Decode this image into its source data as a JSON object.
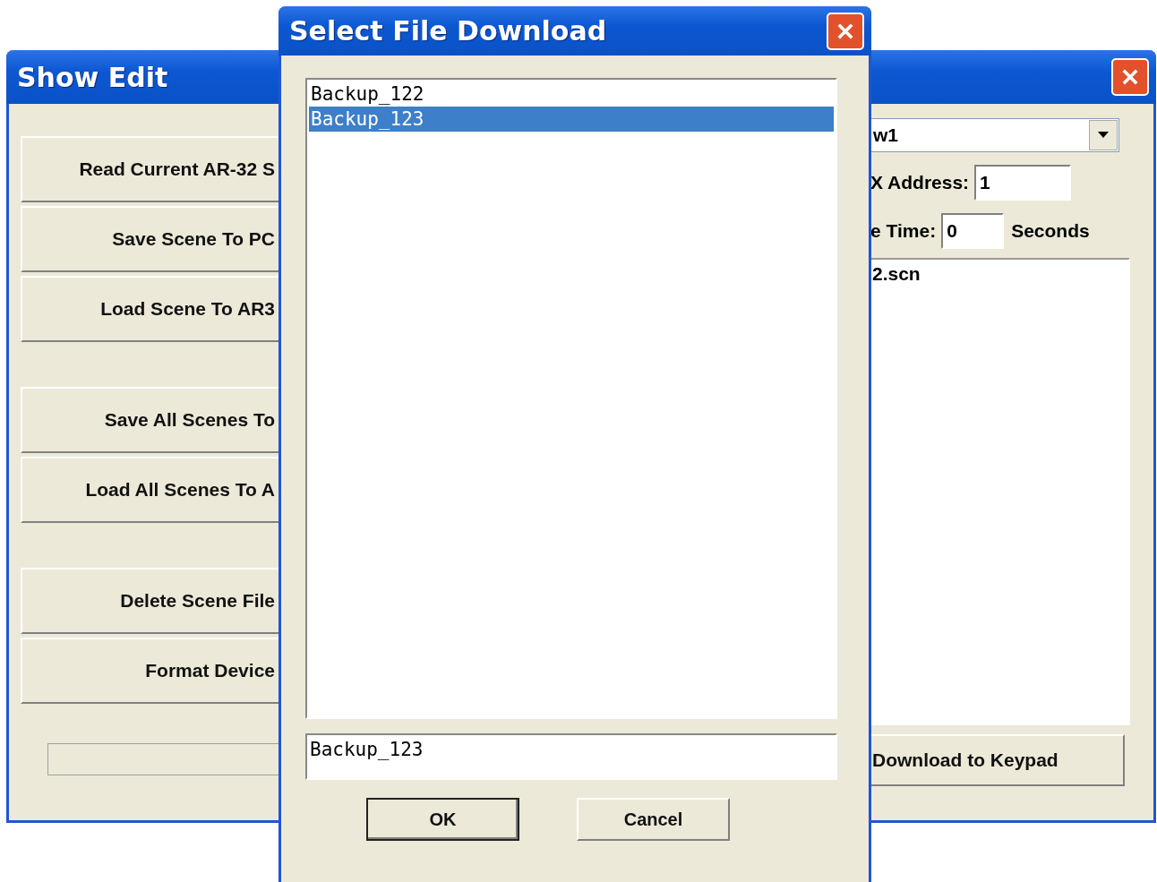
{
  "show_edit_window": {
    "title": "Show Edit",
    "buttons": [
      {
        "label": "Read Current AR-32 S"
      },
      {
        "label": "Save Scene To PC"
      },
      {
        "label": "Load Scene To AR3"
      },
      {
        "label": "Save All Scenes To"
      },
      {
        "label": "Load All Scenes To A"
      },
      {
        "label": "Delete Scene File"
      },
      {
        "label": "Format Device"
      }
    ],
    "progress": {
      "level": 0
    },
    "combo_value": "w1",
    "address_label": "X Address:",
    "address_value": "1",
    "time_label": "e Time:",
    "time_value": "0",
    "time_unit": "Seconds",
    "file_list": [
      "2.scn"
    ],
    "download_button": "Download to Keypad"
  },
  "select_file_dialog": {
    "title": "Select File Download",
    "files": [
      {
        "name": "Backup_122",
        "selected": false
      },
      {
        "name": "Backup_123",
        "selected": true
      }
    ],
    "file_name_value": "Backup_123",
    "buttons": [
      {
        "label": "OK",
        "default": true
      },
      {
        "label": "Cancel",
        "default": false
      }
    ]
  }
}
